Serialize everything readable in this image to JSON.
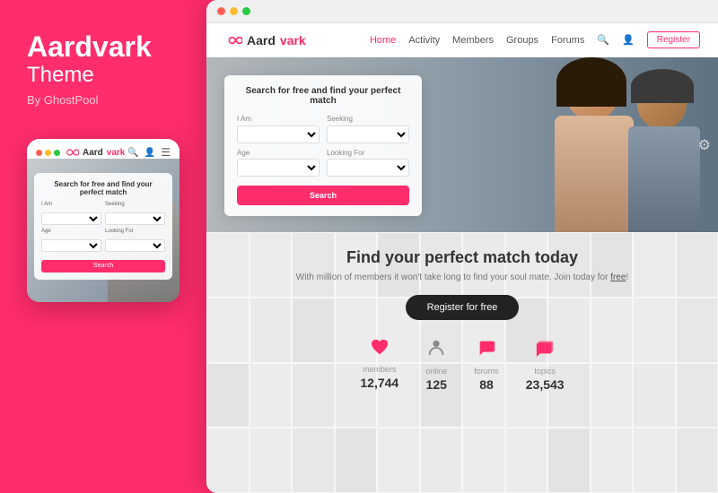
{
  "left": {
    "brand_bold": "Aardvark",
    "brand_light": "Theme",
    "brand_by": "By GhostPool"
  },
  "mobile": {
    "logo_text_black": "Aard",
    "logo_text_pink": "vark",
    "search_title": "Search for free and find your perfect match",
    "i_am_label": "I Am",
    "seeking_label": "Seeking",
    "age_label": "Age",
    "looking_for_label": "Looking For",
    "search_btn": "Search"
  },
  "browser": {
    "dots": [
      "red",
      "yellow",
      "green"
    ]
  },
  "desktop_nav": {
    "logo_black": "Aard",
    "logo_pink": "vark",
    "links": [
      {
        "label": "Home",
        "active": true
      },
      {
        "label": "Activity"
      },
      {
        "label": "Members"
      },
      {
        "label": "Groups"
      },
      {
        "label": "Forums"
      }
    ],
    "register_btn": "Register"
  },
  "hero": {
    "search_form_title": "Search for free and find your perfect match",
    "i_am_label": "I Am",
    "seeking_label": "Seeking",
    "age_label": "Age",
    "looking_for_label": "Looking For",
    "search_btn": "Search"
  },
  "lower": {
    "find_title": "Find your perfect match today",
    "find_sub_before": "With million of members it won't take long to find your soul mate. Join today for ",
    "find_sub_link": "free",
    "find_sub_after": "!",
    "register_btn": "Register for free",
    "stats": [
      {
        "icon": "heart",
        "label": "members",
        "value": "12,744"
      },
      {
        "icon": "user",
        "label": "online",
        "value": "125"
      },
      {
        "icon": "chat",
        "label": "forums",
        "value": "88"
      },
      {
        "icon": "chat2",
        "label": "topics",
        "value": "23,543"
      }
    ]
  },
  "colors": {
    "pink": "#ff2d6b",
    "dark": "#222222",
    "dot_red": "#ff5f57",
    "dot_yellow": "#ffbd2e",
    "dot_green": "#28ca41"
  }
}
